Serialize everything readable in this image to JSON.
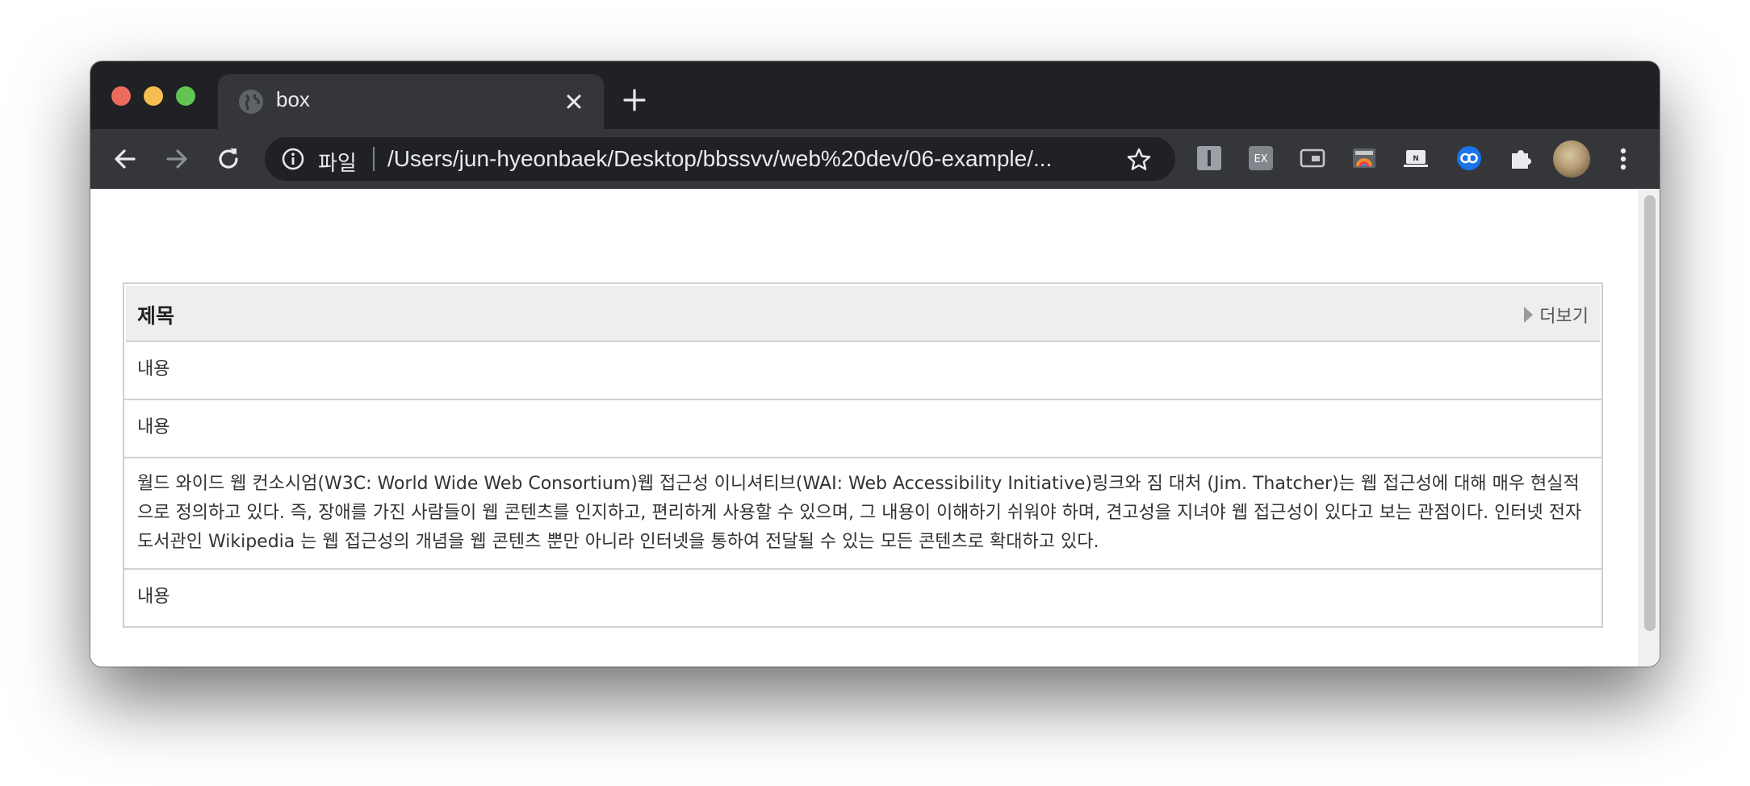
{
  "browser": {
    "tab_title": "box",
    "scheme_label": "파일",
    "url": "/Users/jun-hyeonbaek/Desktop/bbssvv/web%20dev/06-example/..."
  },
  "toolbar": {
    "extensions": [
      "text-extension-icon",
      "ex-extension-icon",
      "picture-in-picture-icon",
      "palette-extension-icon",
      "notion-extension-icon",
      "link-extension-icon",
      "puzzle-icon"
    ]
  },
  "box": {
    "title": "제목",
    "more_label": "더보기",
    "rows": [
      "내용",
      "내용",
      "월드 와이드 웹 컨소시엄(W3C: World Wide Web Consortium)웹 접근성 이니셔티브(WAI: Web Accessibility Initiative)링크와 짐 대처 (Jim. Thatcher)는 웹 접근성에 대해 매우 현실적으로 정의하고 있다. 즉, 장애를 가진 사람들이 웹 콘텐츠를 인지하고, 편리하게 사용할 수 있으며, 그 내용이 이해하기 쉬워야 하며, 견고성을 지녀야 웹 접근성이 있다고 보는 관점이다. 인터넷 전자도서관인 Wikipedia 는 웹 접근성의 개념을 웹 콘텐츠 뿐만 아니라 인터넷을 통하여 전달될 수 있는 모든 콘텐츠로 확대하고 있다.",
      "내용"
    ]
  },
  "colors": {
    "titlebar": "#202124",
    "toolbar": "#35363a",
    "box_header": "#eeeeee",
    "box_border": "#d0d0d0"
  }
}
